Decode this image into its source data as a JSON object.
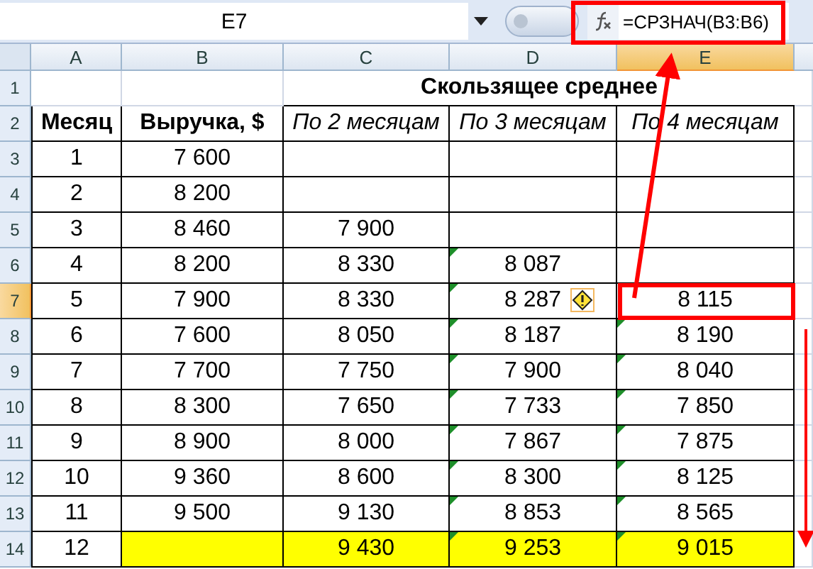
{
  "name_box": "E7",
  "formula": "=СРЗНАЧ(B3:B6)",
  "columns": [
    {
      "label": "A",
      "selected": false
    },
    {
      "label": "B",
      "selected": false
    },
    {
      "label": "C",
      "selected": false
    },
    {
      "label": "D",
      "selected": false
    },
    {
      "label": "E",
      "selected": true
    }
  ],
  "title_row": "1",
  "header_row": "2",
  "title": "Скользящее среднее",
  "headers": [
    "Месяц",
    "Выручка, $",
    "По 2 месяцам",
    "По 3 месяцам",
    "По 4 месяцам"
  ],
  "rows": [
    {
      "number": "3",
      "selected": false,
      "cells": [
        {
          "text": "1",
          "flag": false,
          "highlighted": false
        },
        {
          "text": "7 600",
          "flag": false,
          "highlighted": false
        },
        {
          "flag": false,
          "highlighted": false
        },
        {
          "flag": false,
          "highlighted": false
        },
        {
          "flag": false,
          "highlighted": false
        }
      ]
    },
    {
      "number": "4",
      "selected": false,
      "cells": [
        {
          "text": "2",
          "flag": false,
          "highlighted": false
        },
        {
          "text": "8 200",
          "flag": false,
          "highlighted": false
        },
        {
          "flag": false,
          "highlighted": false
        },
        {
          "flag": false,
          "highlighted": false
        },
        {
          "flag": false,
          "highlighted": false
        }
      ]
    },
    {
      "number": "5",
      "selected": false,
      "cells": [
        {
          "text": "3",
          "flag": false,
          "highlighted": false
        },
        {
          "text": "8 460",
          "flag": false,
          "highlighted": false
        },
        {
          "text": "7 900",
          "flag": false,
          "highlighted": false
        },
        {
          "flag": false,
          "highlighted": false
        },
        {
          "flag": false,
          "highlighted": false
        }
      ]
    },
    {
      "number": "6",
      "selected": false,
      "cells": [
        {
          "text": "4",
          "flag": false,
          "highlighted": false
        },
        {
          "text": "8 200",
          "flag": false,
          "highlighted": false
        },
        {
          "text": "8 330",
          "flag": false,
          "highlighted": false
        },
        {
          "text": "8 087",
          "flag": true,
          "highlighted": false
        },
        {
          "flag": false,
          "highlighted": false
        }
      ]
    },
    {
      "number": "7",
      "selected": true,
      "cells": [
        {
          "text": "5",
          "flag": false,
          "highlighted": false
        },
        {
          "text": "7 900",
          "flag": false,
          "highlighted": false
        },
        {
          "text": "8 330",
          "flag": false,
          "highlighted": false
        },
        {
          "text": "8 287",
          "flag": true,
          "highlighted": false,
          "warning": true
        },
        {
          "text": "8 115",
          "flag": false,
          "highlighted": false
        }
      ]
    },
    {
      "number": "8",
      "selected": false,
      "cells": [
        {
          "text": "6",
          "flag": false,
          "highlighted": false
        },
        {
          "text": "7 600",
          "flag": false,
          "highlighted": false
        },
        {
          "text": "8 050",
          "flag": false,
          "highlighted": false
        },
        {
          "text": "8 187",
          "flag": true,
          "highlighted": false
        },
        {
          "text": "8 190",
          "flag": true,
          "highlighted": false
        }
      ]
    },
    {
      "number": "9",
      "selected": false,
      "cells": [
        {
          "text": "7",
          "flag": false,
          "highlighted": false
        },
        {
          "text": "7 700",
          "flag": false,
          "highlighted": false
        },
        {
          "text": "7 750",
          "flag": false,
          "highlighted": false
        },
        {
          "text": "7 900",
          "flag": true,
          "highlighted": false
        },
        {
          "text": "8 040",
          "flag": true,
          "highlighted": false
        }
      ]
    },
    {
      "number": "10",
      "selected": false,
      "cells": [
        {
          "text": "8",
          "flag": false,
          "highlighted": false
        },
        {
          "text": "8 300",
          "flag": false,
          "highlighted": false
        },
        {
          "text": "7 650",
          "flag": false,
          "highlighted": false
        },
        {
          "text": "7 733",
          "flag": true,
          "highlighted": false
        },
        {
          "text": "7 850",
          "flag": true,
          "highlighted": false
        }
      ]
    },
    {
      "number": "11",
      "selected": false,
      "cells": [
        {
          "text": "9",
          "flag": false,
          "highlighted": false
        },
        {
          "text": "8 900",
          "flag": false,
          "highlighted": false
        },
        {
          "text": "8 000",
          "flag": false,
          "highlighted": false
        },
        {
          "text": "7 867",
          "flag": true,
          "highlighted": false
        },
        {
          "text": "7 875",
          "flag": true,
          "highlighted": false
        }
      ]
    },
    {
      "number": "12",
      "selected": false,
      "cells": [
        {
          "text": "10",
          "flag": false,
          "highlighted": false
        },
        {
          "text": "9 360",
          "flag": false,
          "highlighted": false
        },
        {
          "text": "8 600",
          "flag": false,
          "highlighted": false
        },
        {
          "text": "8 300",
          "flag": true,
          "highlighted": false
        },
        {
          "text": "8 125",
          "flag": true,
          "highlighted": false
        }
      ]
    },
    {
      "number": "13",
      "selected": false,
      "cells": [
        {
          "text": "11",
          "flag": false,
          "highlighted": false
        },
        {
          "text": "9 500",
          "flag": false,
          "highlighted": false
        },
        {
          "text": "9 130",
          "flag": false,
          "highlighted": false
        },
        {
          "text": "8 853",
          "flag": true,
          "highlighted": false
        },
        {
          "text": "8 565",
          "flag": true,
          "highlighted": false
        }
      ]
    },
    {
      "number": "14",
      "selected": false,
      "cells": [
        {
          "text": "12",
          "flag": false,
          "highlighted": false
        },
        {
          "flag": false,
          "highlighted": true
        },
        {
          "text": "9 430",
          "flag": false,
          "highlighted": true
        },
        {
          "text": "9 253",
          "flag": true,
          "highlighted": true
        },
        {
          "text": "9 015",
          "flag": true,
          "highlighted": true
        }
      ]
    }
  ]
}
